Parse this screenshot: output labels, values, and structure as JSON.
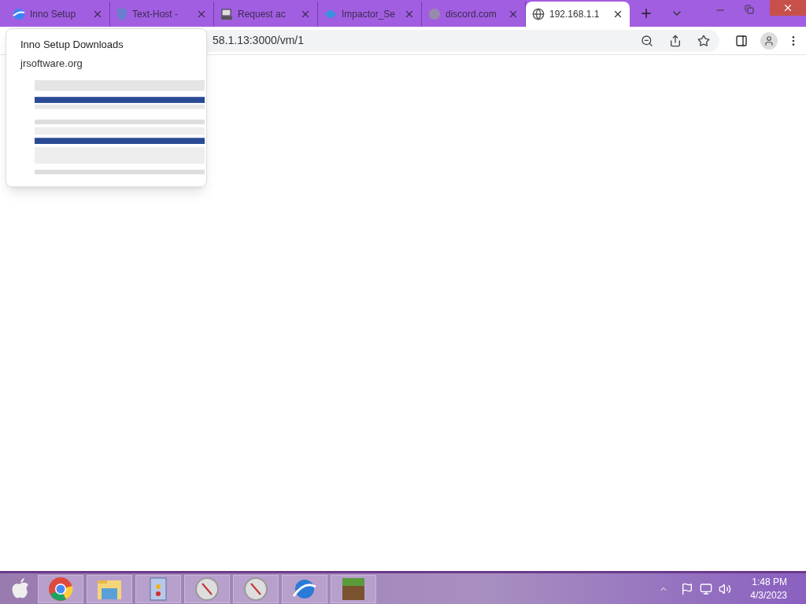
{
  "tabs": [
    {
      "title": "Inno Setup",
      "selected": false
    },
    {
      "title": "Text-Host -",
      "selected": false
    },
    {
      "title": "Request ac",
      "selected": false
    },
    {
      "title": "Impactor_Se",
      "selected": false
    },
    {
      "title": "discord.com",
      "selected": false
    },
    {
      "title": "192.168.1.1",
      "selected": true
    }
  ],
  "address": "58.1.13:3000/vm/1",
  "hover_card": {
    "title": "Inno Setup Downloads",
    "domain": "jrsoftware.org"
  },
  "taskbar": {
    "time": "1:48 PM",
    "date": "4/3/2023"
  }
}
